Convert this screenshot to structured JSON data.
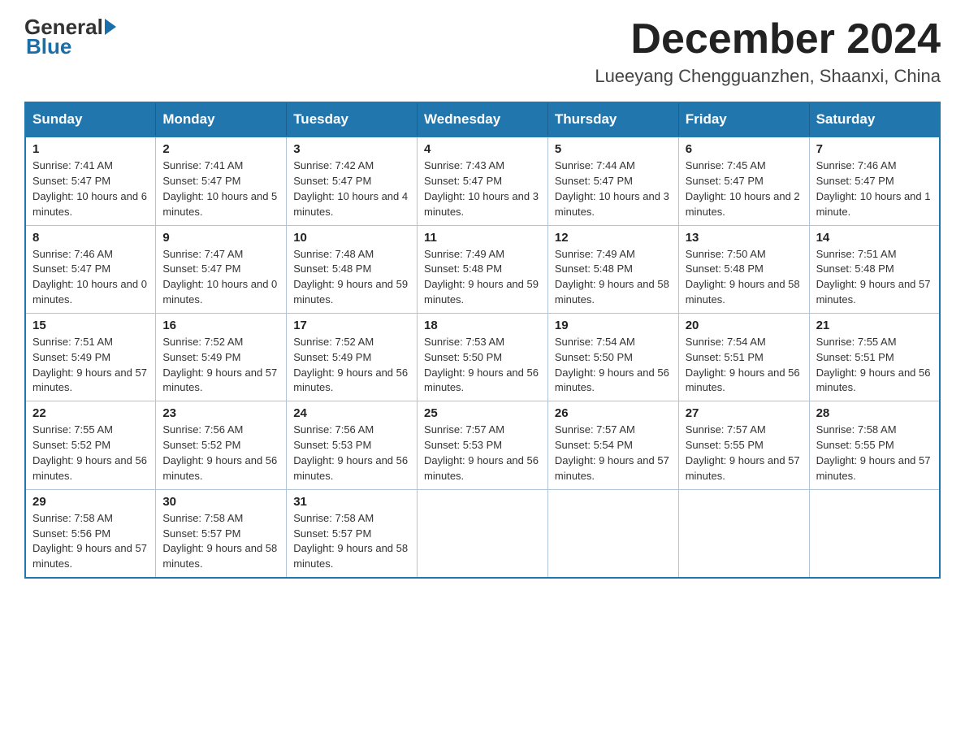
{
  "header": {
    "logo": {
      "general": "General",
      "blue": "Blue"
    },
    "title": "December 2024",
    "location": "Lueeyang Chengguanzhen, Shaanxi, China"
  },
  "columns": [
    "Sunday",
    "Monday",
    "Tuesday",
    "Wednesday",
    "Thursday",
    "Friday",
    "Saturday"
  ],
  "weeks": [
    [
      {
        "day": "1",
        "sunrise": "7:41 AM",
        "sunset": "5:47 PM",
        "daylight": "10 hours and 6 minutes."
      },
      {
        "day": "2",
        "sunrise": "7:41 AM",
        "sunset": "5:47 PM",
        "daylight": "10 hours and 5 minutes."
      },
      {
        "day": "3",
        "sunrise": "7:42 AM",
        "sunset": "5:47 PM",
        "daylight": "10 hours and 4 minutes."
      },
      {
        "day": "4",
        "sunrise": "7:43 AM",
        "sunset": "5:47 PM",
        "daylight": "10 hours and 3 minutes."
      },
      {
        "day": "5",
        "sunrise": "7:44 AM",
        "sunset": "5:47 PM",
        "daylight": "10 hours and 3 minutes."
      },
      {
        "day": "6",
        "sunrise": "7:45 AM",
        "sunset": "5:47 PM",
        "daylight": "10 hours and 2 minutes."
      },
      {
        "day": "7",
        "sunrise": "7:46 AM",
        "sunset": "5:47 PM",
        "daylight": "10 hours and 1 minute."
      }
    ],
    [
      {
        "day": "8",
        "sunrise": "7:46 AM",
        "sunset": "5:47 PM",
        "daylight": "10 hours and 0 minutes."
      },
      {
        "day": "9",
        "sunrise": "7:47 AM",
        "sunset": "5:47 PM",
        "daylight": "10 hours and 0 minutes."
      },
      {
        "day": "10",
        "sunrise": "7:48 AM",
        "sunset": "5:48 PM",
        "daylight": "9 hours and 59 minutes."
      },
      {
        "day": "11",
        "sunrise": "7:49 AM",
        "sunset": "5:48 PM",
        "daylight": "9 hours and 59 minutes."
      },
      {
        "day": "12",
        "sunrise": "7:49 AM",
        "sunset": "5:48 PM",
        "daylight": "9 hours and 58 minutes."
      },
      {
        "day": "13",
        "sunrise": "7:50 AM",
        "sunset": "5:48 PM",
        "daylight": "9 hours and 58 minutes."
      },
      {
        "day": "14",
        "sunrise": "7:51 AM",
        "sunset": "5:48 PM",
        "daylight": "9 hours and 57 minutes."
      }
    ],
    [
      {
        "day": "15",
        "sunrise": "7:51 AM",
        "sunset": "5:49 PM",
        "daylight": "9 hours and 57 minutes."
      },
      {
        "day": "16",
        "sunrise": "7:52 AM",
        "sunset": "5:49 PM",
        "daylight": "9 hours and 57 minutes."
      },
      {
        "day": "17",
        "sunrise": "7:52 AM",
        "sunset": "5:49 PM",
        "daylight": "9 hours and 56 minutes."
      },
      {
        "day": "18",
        "sunrise": "7:53 AM",
        "sunset": "5:50 PM",
        "daylight": "9 hours and 56 minutes."
      },
      {
        "day": "19",
        "sunrise": "7:54 AM",
        "sunset": "5:50 PM",
        "daylight": "9 hours and 56 minutes."
      },
      {
        "day": "20",
        "sunrise": "7:54 AM",
        "sunset": "5:51 PM",
        "daylight": "9 hours and 56 minutes."
      },
      {
        "day": "21",
        "sunrise": "7:55 AM",
        "sunset": "5:51 PM",
        "daylight": "9 hours and 56 minutes."
      }
    ],
    [
      {
        "day": "22",
        "sunrise": "7:55 AM",
        "sunset": "5:52 PM",
        "daylight": "9 hours and 56 minutes."
      },
      {
        "day": "23",
        "sunrise": "7:56 AM",
        "sunset": "5:52 PM",
        "daylight": "9 hours and 56 minutes."
      },
      {
        "day": "24",
        "sunrise": "7:56 AM",
        "sunset": "5:53 PM",
        "daylight": "9 hours and 56 minutes."
      },
      {
        "day": "25",
        "sunrise": "7:57 AM",
        "sunset": "5:53 PM",
        "daylight": "9 hours and 56 minutes."
      },
      {
        "day": "26",
        "sunrise": "7:57 AM",
        "sunset": "5:54 PM",
        "daylight": "9 hours and 57 minutes."
      },
      {
        "day": "27",
        "sunrise": "7:57 AM",
        "sunset": "5:55 PM",
        "daylight": "9 hours and 57 minutes."
      },
      {
        "day": "28",
        "sunrise": "7:58 AM",
        "sunset": "5:55 PM",
        "daylight": "9 hours and 57 minutes."
      }
    ],
    [
      {
        "day": "29",
        "sunrise": "7:58 AM",
        "sunset": "5:56 PM",
        "daylight": "9 hours and 57 minutes."
      },
      {
        "day": "30",
        "sunrise": "7:58 AM",
        "sunset": "5:57 PM",
        "daylight": "9 hours and 58 minutes."
      },
      {
        "day": "31",
        "sunrise": "7:58 AM",
        "sunset": "5:57 PM",
        "daylight": "9 hours and 58 minutes."
      },
      null,
      null,
      null,
      null
    ]
  ],
  "labels": {
    "sunrise": "Sunrise:",
    "sunset": "Sunset:",
    "daylight": "Daylight:"
  }
}
